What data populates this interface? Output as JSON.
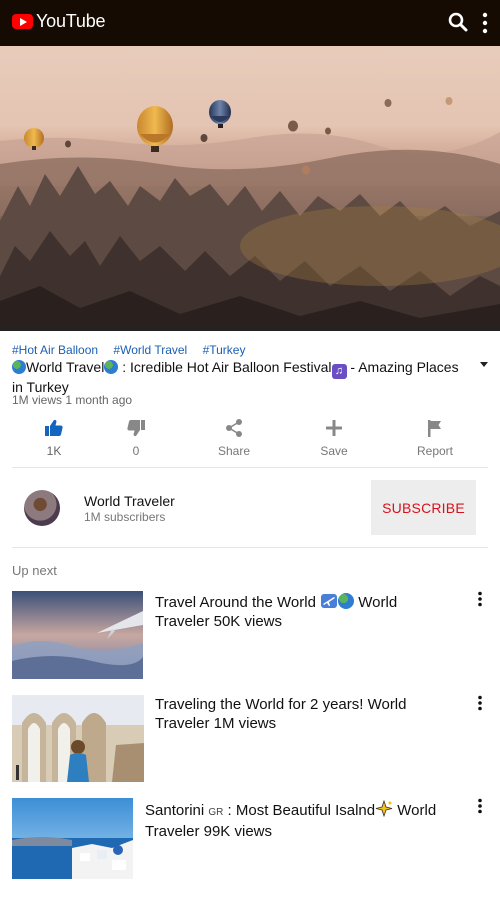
{
  "app": {
    "brand": "YouTube"
  },
  "video": {
    "tags": [
      "#Hot Air Balloon",
      "#World Travel",
      "#Turkey"
    ],
    "title_part1": "World Travel",
    "title_part2": " : Icredible Hot Air Balloon Festival",
    "title_part3": " - Amazing Places in Turkey",
    "views_time": "1M views 1 month ago"
  },
  "actions": {
    "like": "1K",
    "dislike": "0",
    "share": "Share",
    "save": "Save",
    "report": "Report"
  },
  "channel": {
    "name": "World Traveler",
    "subscribers": "1M subscribers",
    "subscribe_label": "SUBSCRIBE"
  },
  "up_next": {
    "heading": "Up next",
    "items": [
      {
        "title_a": "Travel Around the World",
        "title_b": " World Traveler 50K views"
      },
      {
        "title_a": "Traveling the World for 2 years! World Traveler 1M views"
      },
      {
        "title_a": "Santorini ",
        "flag": "GR",
        "title_b": " : Most Beautiful Isalnd",
        "title_c": " World Traveler 99K views"
      }
    ]
  },
  "colors": {
    "topbar": "#160b02",
    "accent_red": "#d9111b",
    "link_blue": "#1a5fb4",
    "like_blue": "#1565c0"
  }
}
